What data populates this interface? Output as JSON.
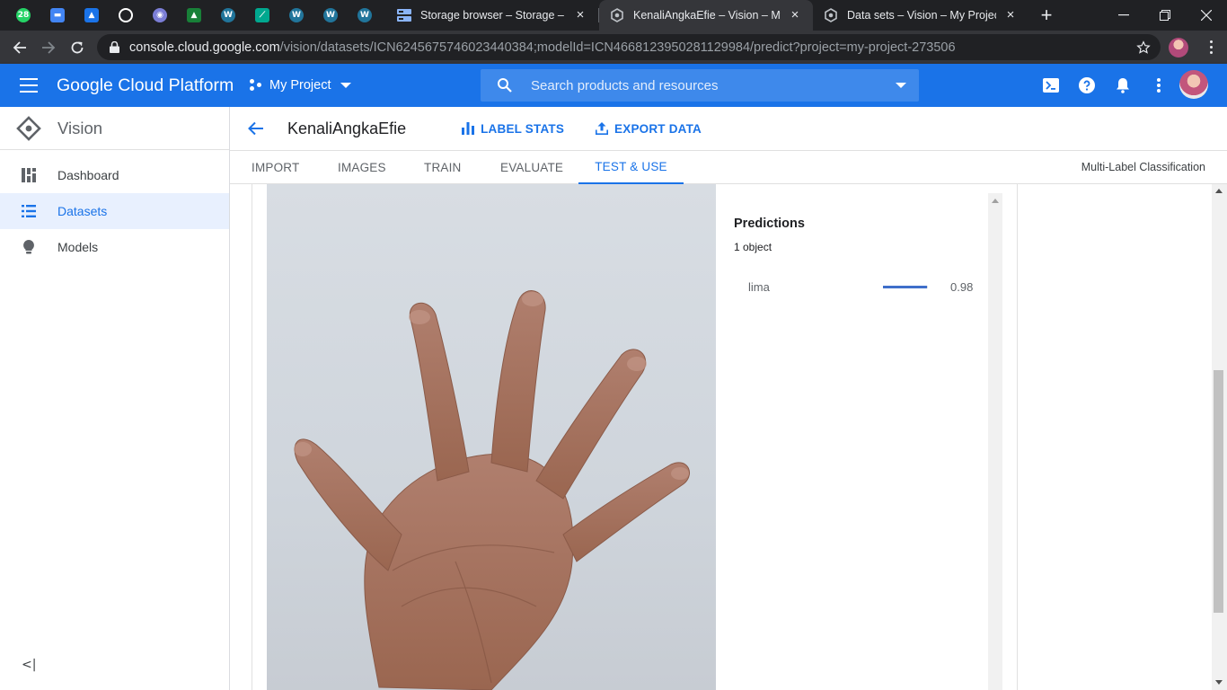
{
  "browser": {
    "pinned_tabs": [
      {
        "icon": "whatsapp-icon",
        "badge": "28",
        "color": "#25d366"
      },
      {
        "icon": "card-icon",
        "color": "#4285f4"
      },
      {
        "icon": "classroom-icon",
        "color": "#1a73e8"
      },
      {
        "icon": "github-icon",
        "color": "#ffffff"
      },
      {
        "icon": "extension-icon",
        "color": "#7b7ed6"
      },
      {
        "icon": "classroom-icon",
        "color": "#188038"
      },
      {
        "icon": "wordpress-icon",
        "color": "#21759b"
      },
      {
        "icon": "leaf-icon",
        "color": "#00a88f"
      },
      {
        "icon": "wordpress-icon",
        "color": "#21759b"
      },
      {
        "icon": "wordpress-icon",
        "color": "#21759b"
      },
      {
        "icon": "wordpress-icon",
        "color": "#21759b"
      }
    ],
    "tabs": [
      {
        "title": "Storage browser – Storage – My Project",
        "icon": "storage-icon",
        "active": false
      },
      {
        "title": "KenaliAngkaEfie – Vision – My Project",
        "icon": "gcp-hex-icon",
        "active": true
      },
      {
        "title": "Data sets – Vision – My Project – Google",
        "icon": "gcp-hex-icon",
        "active": false
      }
    ],
    "url_host": "console.cloud.google.com",
    "url_path": "/vision/datasets/ICN6245675746023440384;modelId=ICN4668123950281129984/predict?project=my-project-273506"
  },
  "header": {
    "brand": "Google Cloud Platform",
    "project": "My Project",
    "search_placeholder": "Search products and resources",
    "accent": "#1a73e8"
  },
  "sidenav": {
    "product": "Vision",
    "items": [
      {
        "label": "Dashboard",
        "icon": "dashboard-icon",
        "active": false
      },
      {
        "label": "Datasets",
        "icon": "list-icon",
        "active": true
      },
      {
        "label": "Models",
        "icon": "lightbulb-icon",
        "active": false
      }
    ],
    "collapse": "<|"
  },
  "page": {
    "title": "KenaliAngkaEfie",
    "actions": [
      {
        "label": "LABEL STATS",
        "icon": "bar-chart-icon"
      },
      {
        "label": "EXPORT DATA",
        "icon": "export-icon"
      }
    ],
    "tabs": [
      "IMPORT",
      "IMAGES",
      "TRAIN",
      "EVALUATE",
      "TEST & USE"
    ],
    "active_tab": "TEST & USE",
    "model_type": "Multi-Label Classification"
  },
  "predictions": {
    "title": "Predictions",
    "count": "1 object",
    "items": [
      {
        "label": "lima",
        "score": "0.98",
        "score_value": 0.98,
        "bar_color": "#3f6fca"
      }
    ]
  }
}
